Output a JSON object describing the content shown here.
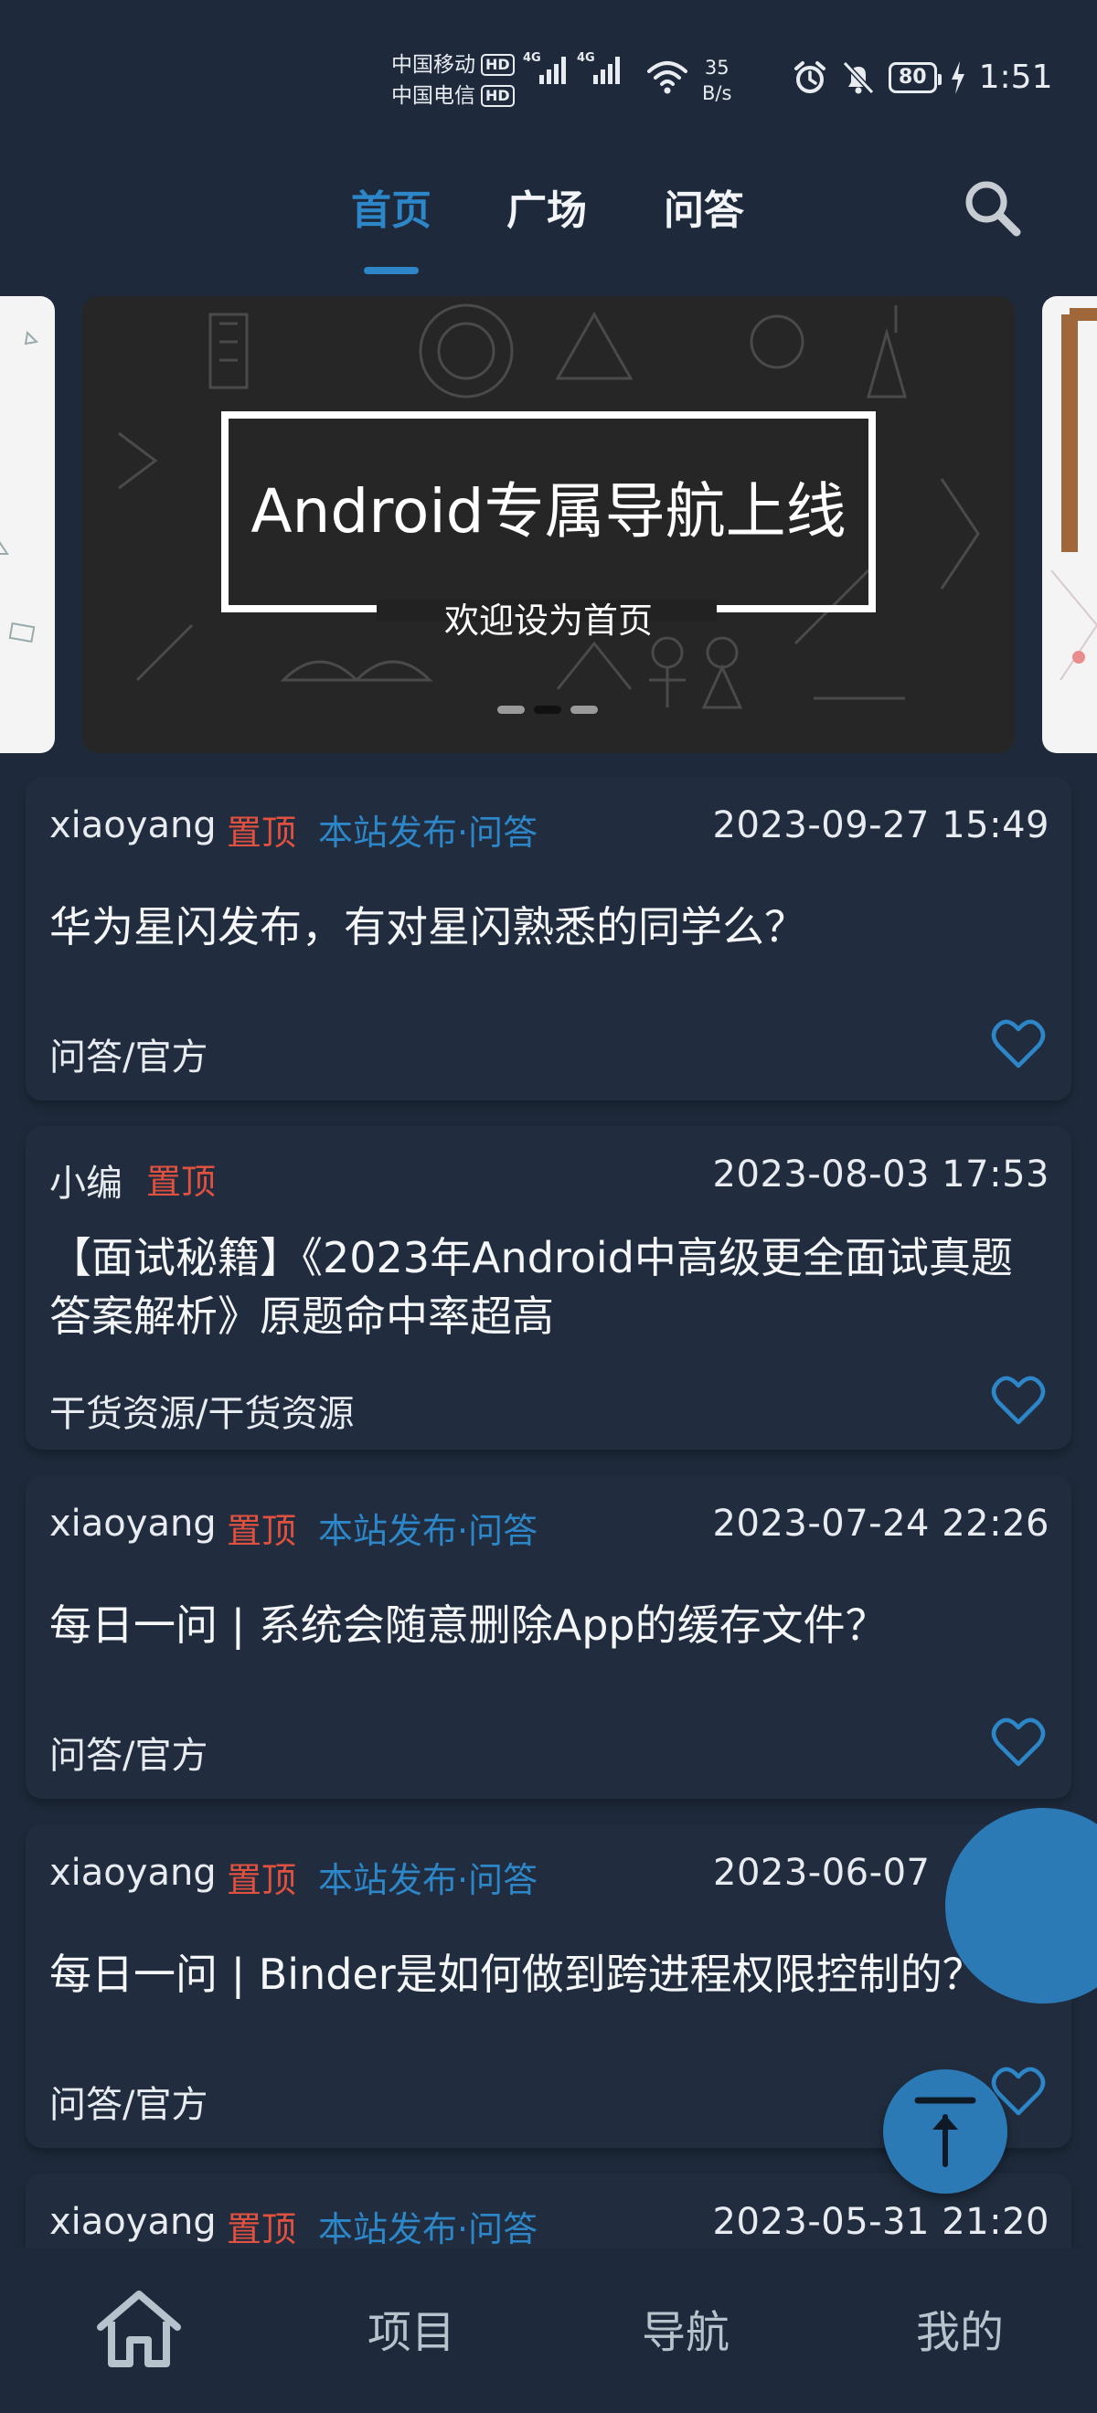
{
  "status_bar": {
    "carrier_1": "中国移动",
    "carrier_2": "中国电信",
    "hd": "HD",
    "network_1": "4G",
    "network_2": "4G",
    "speed_value": "35",
    "speed_unit": "B/s",
    "battery": "80",
    "time": "1:51"
  },
  "top_tabs": [
    {
      "label": "首页",
      "active": true
    },
    {
      "label": "广场",
      "active": false
    },
    {
      "label": "问答",
      "active": false
    }
  ],
  "banner": {
    "title": "Android专属导航上线",
    "subtitle": "欢迎设为首页",
    "page_count": 3,
    "active_page": 2
  },
  "articles": [
    {
      "author": "xiaoyang",
      "top_label": "置顶",
      "source_label": "本站发布·问答",
      "date": "2023-09-27 15:49",
      "title": "华为星闪发布，有对星闪熟悉的同学么？",
      "category": "问答/官方"
    },
    {
      "author": "小编",
      "top_label": "置顶",
      "source_label": "",
      "date": "2023-08-03 17:53",
      "title": "【面试秘籍】《2023年Android中高级更全面试真题答案解析》原题命中率超高",
      "category": "干货资源/干货资源"
    },
    {
      "author": "xiaoyang",
      "top_label": "置顶",
      "source_label": "本站发布·问答",
      "date": "2023-07-24 22:26",
      "title": "每日一问 | 系统会随意删除App的缓存文件？",
      "category": "问答/官方"
    },
    {
      "author": "xiaoyang",
      "top_label": "置顶",
      "source_label": "本站发布·问答",
      "date": "2023-06-07",
      "title": "每日一问 | Binder是如何做到跨进程权限控制的？",
      "category": "问答/官方"
    },
    {
      "author": "xiaoyang",
      "top_label": "置顶",
      "source_label": "本站发布·问答",
      "date": "2023-05-31 21:20",
      "title": "",
      "category": ""
    }
  ],
  "bottom_nav": [
    {
      "label": "",
      "icon": "home-icon",
      "active": true
    },
    {
      "label": "项目",
      "active": false
    },
    {
      "label": "导航",
      "active": false
    },
    {
      "label": "我的",
      "active": false
    }
  ],
  "colors": {
    "background": "#1e2a3b",
    "card": "#212d3e",
    "accent": "#2c86c8",
    "top_label": "#e0513f",
    "fab": "#2b7ab6"
  }
}
